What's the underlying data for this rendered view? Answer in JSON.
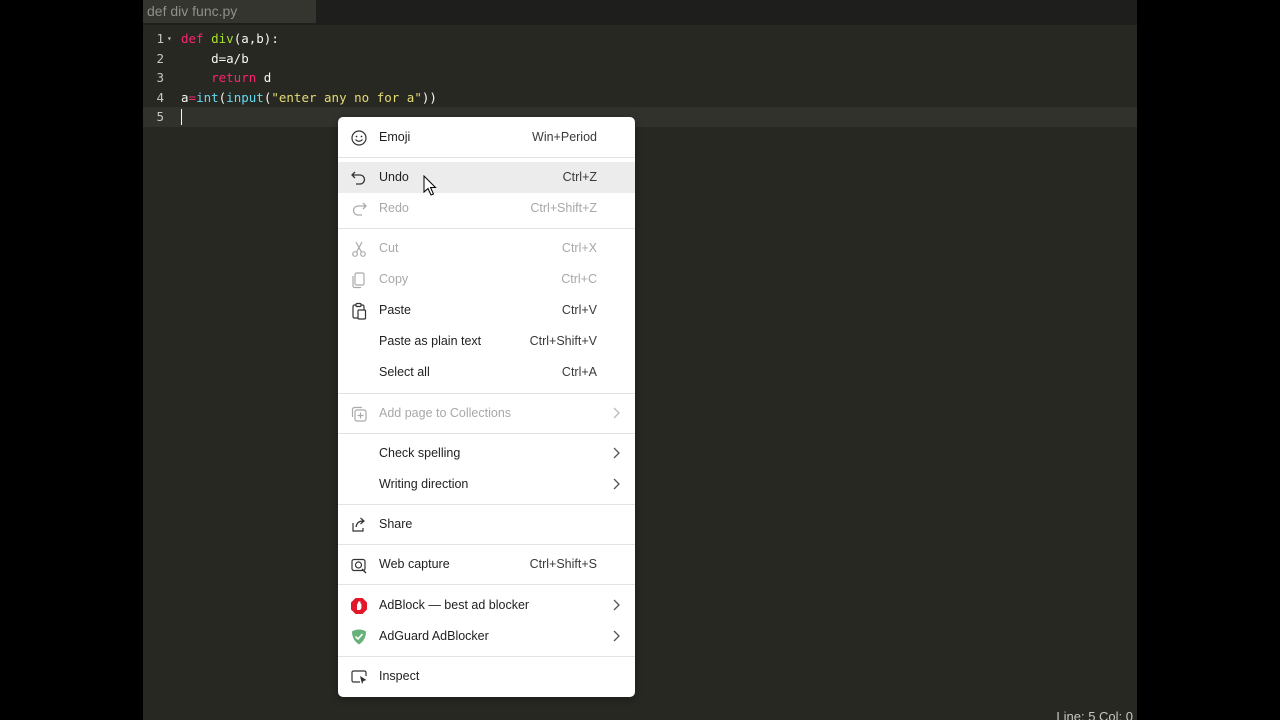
{
  "editor": {
    "tab_title": "def div func.py",
    "status": "Line: 5 Col: 0",
    "lines": [
      {
        "num": "1",
        "tokens": [
          {
            "t": "def",
            "c": "kw"
          },
          {
            "t": " "
          },
          {
            "t": "div",
            "c": "fn"
          },
          {
            "t": "(a,b):"
          }
        ]
      },
      {
        "num": "2",
        "tokens": [
          {
            "t": "    d=a/b"
          }
        ]
      },
      {
        "num": "3",
        "tokens": [
          {
            "t": "    "
          },
          {
            "t": "return",
            "c": "kw"
          },
          {
            "t": " d"
          }
        ]
      },
      {
        "num": "4",
        "tokens": [
          {
            "t": "a"
          },
          {
            "t": "=",
            "c": "kw"
          },
          {
            "t": "int",
            "c": "bi"
          },
          {
            "t": "("
          },
          {
            "t": "input",
            "c": "bi"
          },
          {
            "t": "("
          },
          {
            "t": "\"enter any no for a\"",
            "c": "str"
          },
          {
            "t": "))"
          }
        ]
      },
      {
        "num": "5",
        "tokens": []
      }
    ]
  },
  "context_menu": {
    "items": [
      {
        "id": "emoji",
        "label": "Emoji",
        "shortcut": "Win+Period",
        "icon": "smiley-icon"
      },
      {
        "id": "undo",
        "label": "Undo",
        "shortcut": "Ctrl+Z",
        "icon": "undo-icon"
      },
      {
        "id": "redo",
        "label": "Redo",
        "shortcut": "Ctrl+Shift+Z",
        "icon": "redo-icon"
      },
      {
        "id": "cut",
        "label": "Cut",
        "shortcut": "Ctrl+X",
        "icon": "scissors-icon"
      },
      {
        "id": "copy",
        "label": "Copy",
        "shortcut": "Ctrl+C",
        "icon": "copy-icon"
      },
      {
        "id": "paste",
        "label": "Paste",
        "shortcut": "Ctrl+V",
        "icon": "clipboard-icon"
      },
      {
        "id": "paste-plain",
        "label": "Paste as plain text",
        "shortcut": "Ctrl+Shift+V"
      },
      {
        "id": "select-all",
        "label": "Select all",
        "shortcut": "Ctrl+A"
      },
      {
        "id": "collections",
        "label": "Add page to Collections",
        "icon": "collections-icon"
      },
      {
        "id": "spelling",
        "label": "Check spelling"
      },
      {
        "id": "writing-direction",
        "label": "Writing direction"
      },
      {
        "id": "share",
        "label": "Share",
        "icon": "share-icon"
      },
      {
        "id": "web-capture",
        "label": "Web capture",
        "shortcut": "Ctrl+Shift+S",
        "icon": "web-capture-icon"
      },
      {
        "id": "adblock",
        "label": "AdBlock — best ad blocker",
        "icon": "adblock-icon"
      },
      {
        "id": "adguard",
        "label": "AdGuard AdBlocker",
        "icon": "adguard-icon"
      },
      {
        "id": "inspect",
        "label": "Inspect",
        "icon": "inspect-icon"
      }
    ],
    "disabled": [
      "redo",
      "cut",
      "copy",
      "collections"
    ],
    "hovered": "undo",
    "has_submenu": [
      "collections",
      "spelling",
      "writing-direction",
      "adblock",
      "adguard"
    ],
    "colors": {
      "adblock": "#e1172a",
      "adguard": "#67b279",
      "disabled": "#a8a8a8"
    }
  }
}
